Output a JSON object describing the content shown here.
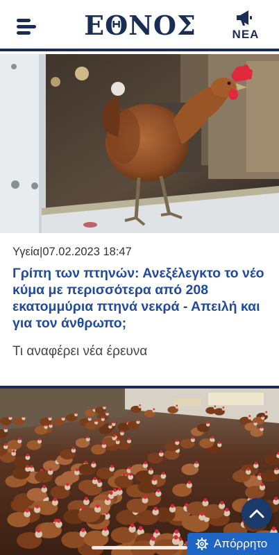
{
  "header": {
    "logo": "ΕΘΝΟΣ",
    "nea_label": "ΝΕΑ",
    "menu_icon": "hamburger-menu-icon",
    "nea_icon": "megaphone-icon"
  },
  "articles": [
    {
      "category": "Υγεία",
      "date": "07.02.2023 18:47",
      "title": "Γρίπη των πτηνών: Ανεξέλεγκτο το νέο κύμα με περισσότερα από 208 εκατομμύρια πτηνά νεκρά - Απειλή και για τον άνθρωπο;",
      "subtitle": "Τι αναφέρει νέα έρευνα"
    }
  ],
  "controls": {
    "privacy_label": "Απόρρητο",
    "scroll_top_icon": "chevron-up-icon",
    "privacy_icon": "gear-icon"
  },
  "colors": {
    "brand_navy": "#1a2e55",
    "headline_blue": "#1f4aa0",
    "privacy_blue": "#1f66c4"
  }
}
